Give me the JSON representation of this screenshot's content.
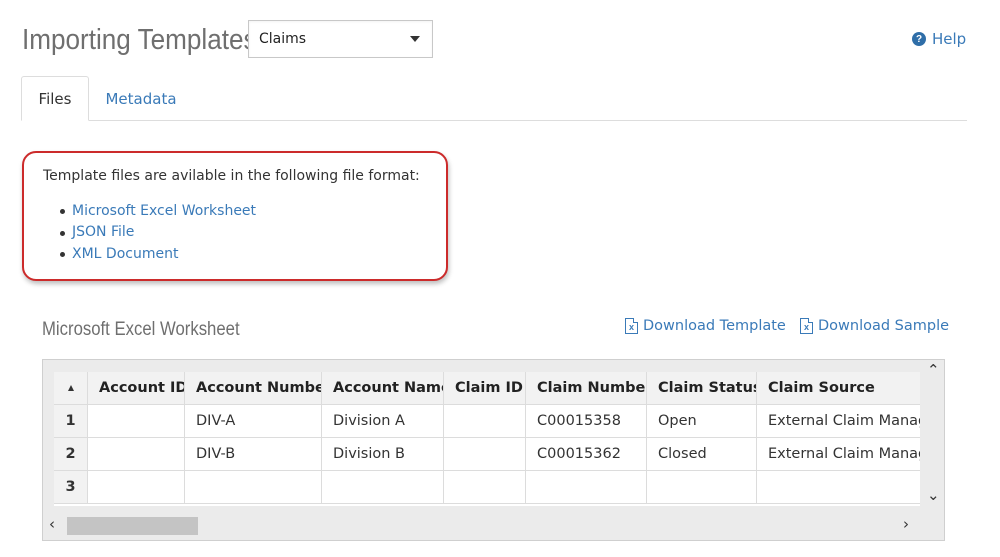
{
  "header": {
    "title": "Importing Templates",
    "select_value": "Claims",
    "help_label": "Help"
  },
  "tabs": [
    {
      "label": "Files",
      "active": true
    },
    {
      "label": "Metadata",
      "active": false
    }
  ],
  "info": {
    "text": "Template files are avilable in the following file format:",
    "formats": [
      "Microsoft Excel Worksheet",
      "JSON File",
      "XML Document"
    ]
  },
  "section": {
    "title": "Microsoft Excel Worksheet",
    "download_template": "Download Template",
    "download_sample": "Download Sample"
  },
  "grid": {
    "columns": [
      "Account ID",
      "Account Number",
      "Account Name",
      "Claim ID",
      "Claim Number",
      "Claim Status",
      "Claim Source"
    ],
    "rows": [
      {
        "num": "1",
        "cells": [
          "",
          "DIV-A",
          "Division A",
          "",
          "C00015358",
          "Open",
          "External Claim Manag"
        ]
      },
      {
        "num": "2",
        "cells": [
          "",
          "DIV-B",
          "Division B",
          "",
          "C00015362",
          "Closed",
          "External Claim Manag"
        ]
      },
      {
        "num": "3",
        "cells": [
          "",
          "",
          "",
          "",
          "",
          "",
          ""
        ]
      }
    ]
  },
  "colors": {
    "link": "#3a7ab8",
    "highlight_border": "#cc2b2b",
    "title_gray": "#6f6f6f"
  },
  "icons": {
    "help": "question-circle-icon",
    "download": "excel-file-icon",
    "caret": "chevron-down-icon"
  }
}
